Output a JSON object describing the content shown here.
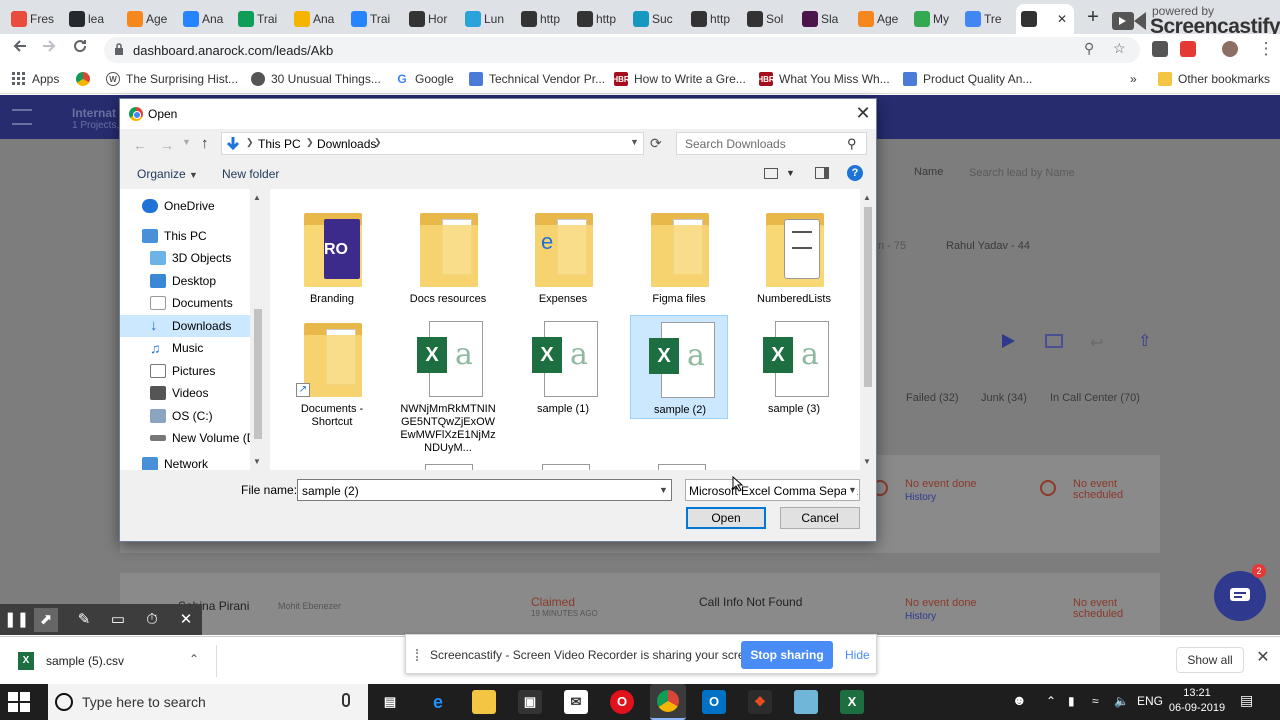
{
  "browser": {
    "tabs": [
      {
        "title": "Fres",
        "icon": "colorful-icon",
        "color": "#e84c3d"
      },
      {
        "title": "lea",
        "icon": "github-icon",
        "color": "#24292e"
      },
      {
        "title": "Age",
        "icon": "freshdesk-icon",
        "color": "#f6871f"
      },
      {
        "title": "Ana",
        "icon": "jira-icon",
        "color": "#2684ff"
      },
      {
        "title": "Trai",
        "icon": "sheets-icon",
        "color": "#0f9d58"
      },
      {
        "title": "Ana",
        "icon": "slides-icon",
        "color": "#f4b400"
      },
      {
        "title": "Trai",
        "icon": "jira-icon",
        "color": "#2684ff"
      },
      {
        "title": "Hor",
        "icon": "anarock-icon",
        "color": "#333333"
      },
      {
        "title": "Lun",
        "icon": "lunch-icon",
        "color": "#29a3d9"
      },
      {
        "title": "http",
        "icon": "anarock-icon",
        "color": "#333333"
      },
      {
        "title": "http",
        "icon": "anarock-icon",
        "color": "#333333"
      },
      {
        "title": "Suc",
        "icon": "salesforce-icon",
        "color": "#1798c1"
      },
      {
        "title": "http",
        "icon": "anarock-icon",
        "color": "#333333"
      },
      {
        "title": "Sol",
        "icon": "anarock-icon",
        "color": "#333333"
      },
      {
        "title": "Sla",
        "icon": "slack-icon",
        "color": "#4a154b"
      },
      {
        "title": "Age",
        "icon": "freshdesk-icon",
        "color": "#f6871f"
      },
      {
        "title": "My",
        "icon": "drive-icon",
        "color": "#34a853"
      },
      {
        "title": "Tre",
        "icon": "docs-icon",
        "color": "#4285f4"
      },
      {
        "title": "",
        "icon": "anarock-icon",
        "color": "#333333"
      }
    ],
    "new_tab": "+",
    "screencastify": {
      "powered": "powered by",
      "name": "Screencastify"
    },
    "url": "dashboard.anarock.com/leads/Akb",
    "bookmarks": [
      {
        "label": "Apps",
        "icon": "apps-icon"
      },
      {
        "label": "",
        "icon": "chrome-icon"
      },
      {
        "label": "The Surprising Hist...",
        "icon": "wordpress-icon"
      },
      {
        "label": "30 Unusual Things...",
        "icon": "globe-icon"
      },
      {
        "label": "Google",
        "icon": "google-icon"
      },
      {
        "label": "Technical Vendor Pr...",
        "icon": "bookmark-blue-icon"
      },
      {
        "label": "How to Write a Gre...",
        "icon": "hbr-icon"
      },
      {
        "label": "What You Miss Wh...",
        "icon": "hbr-icon"
      },
      {
        "label": "Product Quality An...",
        "icon": "bookmark-blue-icon"
      }
    ],
    "overflow": "»",
    "other_bookmarks": "Other bookmarks"
  },
  "page_bg": {
    "app_title": "Internat",
    "app_subtitle": "1 Projects,",
    "filter_name": "Name",
    "search_placeholder": "Search lead by Name",
    "chip_1": "n - 75",
    "chip_2": "Rahul Yadav - 44",
    "tab_failed": "Failed (32)",
    "tab_junk": "Junk (34)",
    "tab_callcenter": "In Call Center (70)",
    "no_event_1": "No event done",
    "history_1": "History",
    "no_event_sched_1": "No event scheduled",
    "lead_name": "Sabina Pirani",
    "assignee": "Mohit Ebenezer",
    "status": "Claimed",
    "time_ago": "19 MINUTES AGO",
    "call_info": "Call Info Not Found",
    "no_event_2": "No event done",
    "history_2": "History",
    "no_event_sched_2": "No event scheduled",
    "chat_badge": "2"
  },
  "dialog": {
    "title": "Open",
    "close": "✕",
    "path": [
      "This PC",
      "Downloads"
    ],
    "search_placeholder": "Search Downloads",
    "organize": "Organize",
    "new_folder": "New folder",
    "help": "?",
    "nav": [
      {
        "label": "OneDrive",
        "icon": "onedrive-icon"
      },
      {
        "label": "This PC",
        "icon": "computer-icon"
      },
      {
        "label": "3D Objects",
        "icon": "cube-icon"
      },
      {
        "label": "Desktop",
        "icon": "desktop-icon"
      },
      {
        "label": "Documents",
        "icon": "documents-icon"
      },
      {
        "label": "Downloads",
        "icon": "downloads-icon",
        "selected": true
      },
      {
        "label": "Music",
        "icon": "music-icon"
      },
      {
        "label": "Pictures",
        "icon": "pictures-icon"
      },
      {
        "label": "Videos",
        "icon": "videos-icon"
      },
      {
        "label": "OS (C:)",
        "icon": "drive-c-icon"
      },
      {
        "label": "New Volume (D:",
        "icon": "drive-d-icon"
      },
      {
        "label": "Network",
        "icon": "network-icon"
      }
    ],
    "files": [
      {
        "name": "Branding",
        "kind": "folder-branding"
      },
      {
        "name": "Docs resources",
        "kind": "folder"
      },
      {
        "name": "Expenses",
        "kind": "folder-edge"
      },
      {
        "name": "Figma files",
        "kind": "folder"
      },
      {
        "name": "NumberedLists",
        "kind": "folder-list"
      },
      {
        "name": "Documents - Shortcut",
        "kind": "folder-shortcut"
      },
      {
        "name": "NWNjMmRkMTNINGE5NTQwZjExOWEwMWFlXzE1NjMzNDUyM...",
        "kind": "excel"
      },
      {
        "name": "sample (1)",
        "kind": "excel"
      },
      {
        "name": "sample (2)",
        "kind": "excel",
        "selected": true
      },
      {
        "name": "sample (3)",
        "kind": "excel"
      }
    ],
    "file_name_label": "File name:",
    "file_name_value": "sample (2)",
    "file_type": "Microsoft Excel Comma Separa",
    "open": "Open",
    "cancel": "Cancel"
  },
  "download_bar": {
    "file": "sample (5).csv",
    "show_all": "Show all",
    "close": "✕"
  },
  "share_banner": {
    "text": "Screencastify - Screen Video Recorder is sharing your screen.",
    "stop": "Stop sharing",
    "hide": "Hide"
  },
  "taskbar": {
    "search_placeholder": "Type here to search",
    "lang": "ENG",
    "time": "13:21",
    "date": "06-09-2019"
  }
}
